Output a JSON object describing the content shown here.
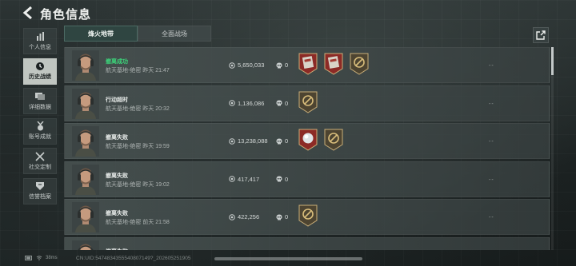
{
  "header": {
    "title": "角色信息"
  },
  "sidebar": {
    "items": [
      {
        "label": "个人信息",
        "icon": "bar-chart-icon",
        "active": false
      },
      {
        "label": "历史战绩",
        "icon": "clock-icon",
        "active": true
      },
      {
        "label": "详细数据",
        "icon": "stack-icon",
        "active": false
      },
      {
        "label": "账号成就",
        "icon": "medal-icon",
        "active": false
      },
      {
        "label": "社交定制",
        "icon": "tools-icon",
        "active": false
      },
      {
        "label": "信誉档案",
        "icon": "shield-icon",
        "active": false
      }
    ]
  },
  "tabs": [
    {
      "label": "烽火地带",
      "active": true
    },
    {
      "label": "全面战场",
      "active": false
    }
  ],
  "records": [
    {
      "status": "撤离成功",
      "meta": "航天基地-绝密 昨天 21:47",
      "money": "5,650,033",
      "kills": "0",
      "items": [
        "red-card-item",
        "red-card-item",
        "gold-badge-item"
      ],
      "dash": "--"
    },
    {
      "status": "行动超时",
      "meta": "航天基地-绝密 昨天 20:32",
      "money": "1,136,086",
      "kills": "0",
      "items": [
        "gold-badge-item"
      ],
      "dash": "--"
    },
    {
      "status": "撤离失败",
      "meta": "航天基地-绝密 昨天 19:59",
      "money": "13,238,088",
      "kills": "0",
      "items": [
        "red-orb-item",
        "gold-badge-item"
      ],
      "dash": "--"
    },
    {
      "status": "撤离失败",
      "meta": "航天基地-绝密 昨天 19:02",
      "money": "417,417",
      "kills": "0",
      "items": [],
      "dash": "--"
    },
    {
      "status": "撤离失败",
      "meta": "航天基地-绝密 前天 21:58",
      "money": "422,256",
      "kills": "0",
      "items": [
        "gold-badge-item"
      ],
      "dash": "--"
    },
    {
      "status": "撤离失败",
      "meta": "",
      "money": "",
      "kills": "",
      "items": [],
      "dash": ""
    }
  ],
  "footer": {
    "ping": "38ms",
    "uid": "CN:UID:5474834355540807149?_202605251905"
  },
  "colors": {
    "success": "#3cd57a",
    "accent_tab": "#2f4541",
    "sidebar_active": "#d2d7d2"
  }
}
